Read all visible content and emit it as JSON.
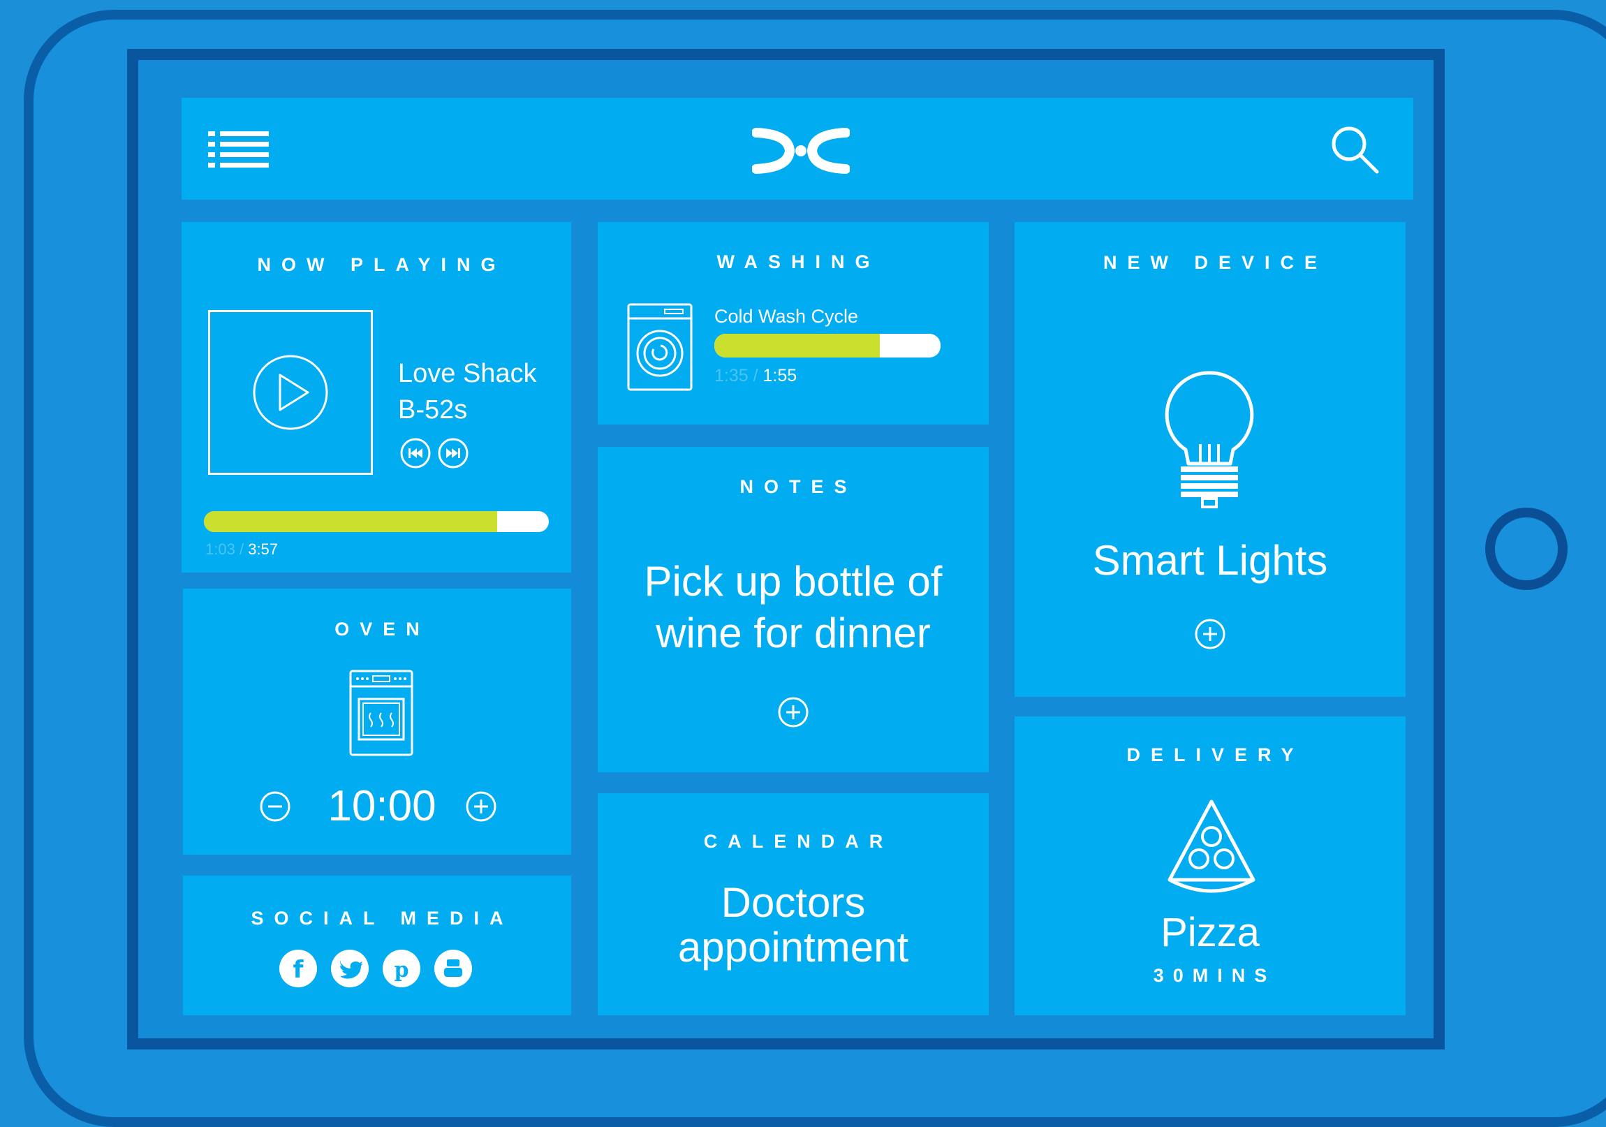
{
  "header": {
    "menu_icon": "menu-list-icon",
    "logo_icon": "brand-logo-icon",
    "search_icon": "search-icon"
  },
  "now_playing": {
    "title": "NOW PLAYING",
    "song": "Love Shack",
    "artist": "B-52s",
    "elapsed": "1:03",
    "separator": "/",
    "duration": "3:57",
    "progress": 0.85
  },
  "oven": {
    "title": "OVEN",
    "timer": "10:00",
    "icon": "oven-icon"
  },
  "social_media": {
    "title": "SOCIAL MEDIA",
    "icons": [
      "facebook-icon",
      "twitter-icon",
      "pinterest-icon",
      "youtube-icon"
    ]
  },
  "washing": {
    "title": "WASHING",
    "cycle": "Cold Wash Cycle",
    "elapsed": "1:35",
    "separator": "/",
    "duration": "1:55",
    "progress": 0.73,
    "icon": "washing-machine-icon"
  },
  "notes": {
    "title": "NOTES",
    "line1": "Pick up bottle of",
    "line2": "wine for dinner"
  },
  "calendar": {
    "title": "CALENDAR",
    "line1": "Doctors",
    "line2": "appointment"
  },
  "new_device": {
    "title": "NEW DEVICE",
    "name": "Smart Lights",
    "icon": "light-bulb-icon"
  },
  "delivery": {
    "title": "DELIVERY",
    "item": "Pizza",
    "eta": "30MINS",
    "icon": "pizza-icon"
  },
  "colors": {
    "tile": "#01acf0",
    "progress_fill": "#cbdf2e",
    "background": "#1b8fd8"
  }
}
